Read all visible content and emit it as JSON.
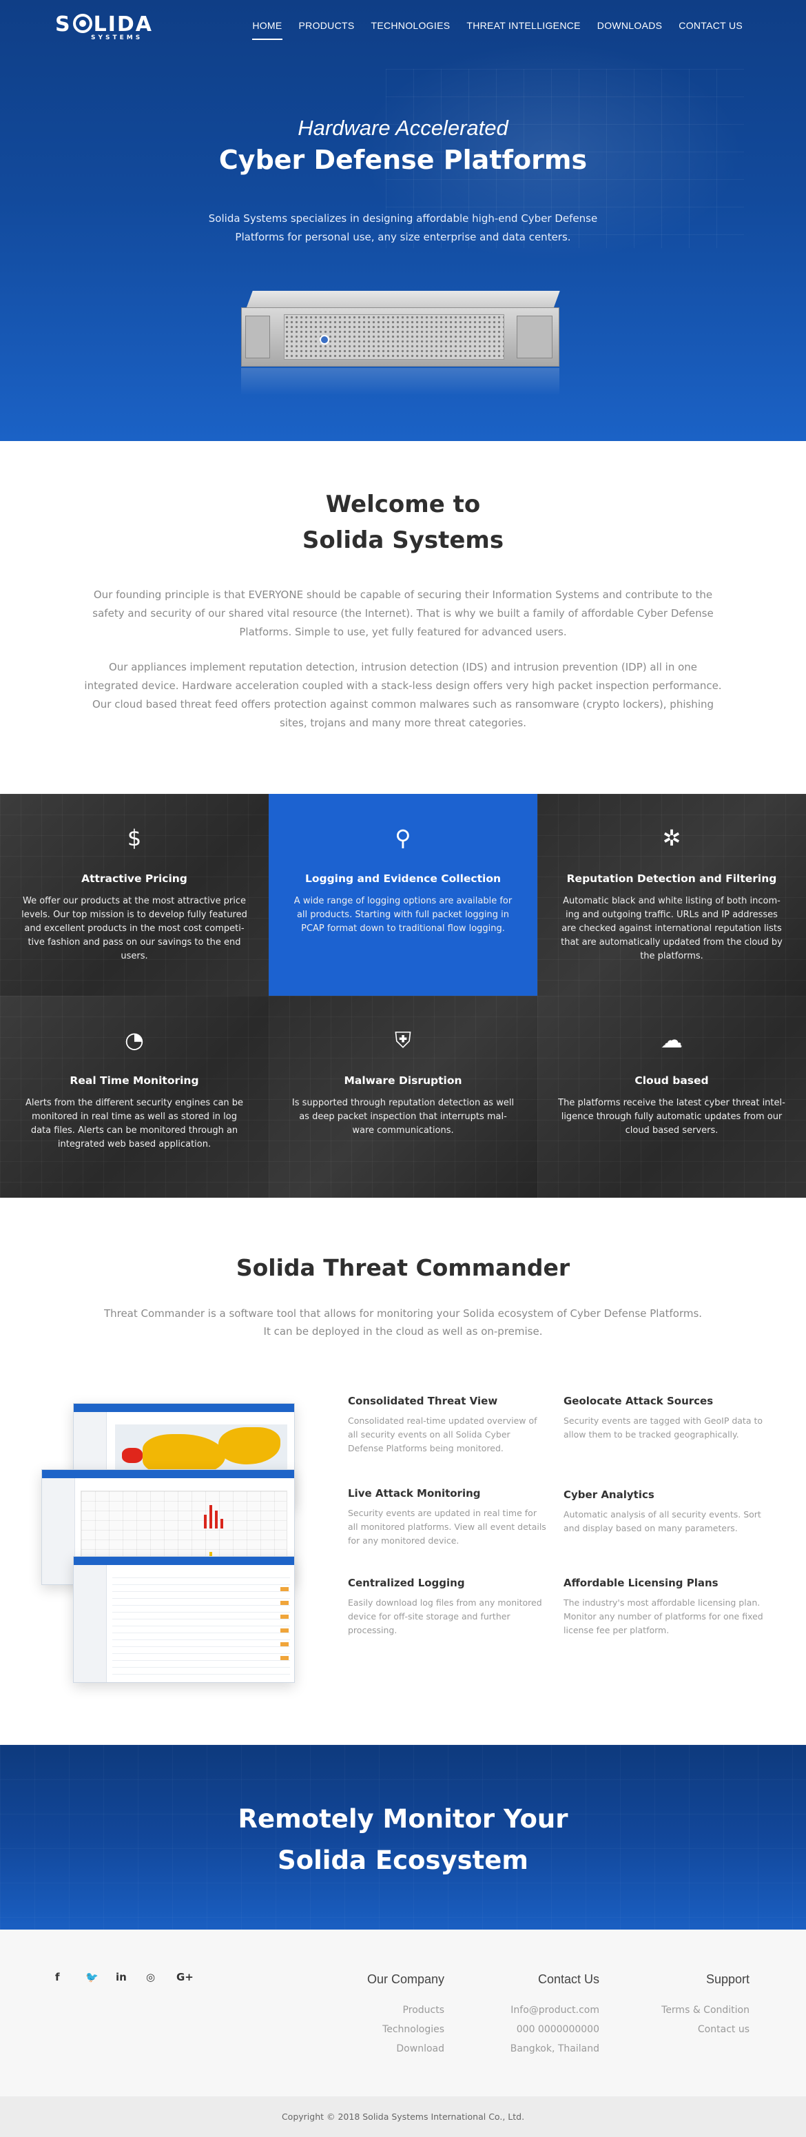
{
  "brand": {
    "name_left": "S",
    "name_right": "LIDA",
    "tagline": "SYSTEMS"
  },
  "nav": [
    {
      "label": "HOME",
      "active": true
    },
    {
      "label": "PRODUCTS",
      "active": false
    },
    {
      "label": "TECHNOLOGIES",
      "active": false
    },
    {
      "label": "THREAT INTELLIGENCE",
      "active": false
    },
    {
      "label": "DOWNLOADS",
      "active": false
    },
    {
      "label": "CONTACT US",
      "active": false
    }
  ],
  "hero": {
    "subtitle": "Hardware Accelerated",
    "title": "Cyber Defense Platforms",
    "text": "Solida Systems specializes in designing affordable high-end Cyber Defense Platforms for personal use, any size enterprise and data centers."
  },
  "welcome": {
    "title_line1": "Welcome to",
    "title_line2": "Solida Systems",
    "p1": "Our founding principle is that EVERYONE should be capable of securing their Information Systems and contribute to the safety and security of our shared vital resource (the Internet). That is why we built a family of affordable Cyber Defense Platforms. Simple to use, yet fully featured for advanced users.",
    "p2": "Our appliances implement reputation detection, intrusion detection (IDS) and intrusion prevention (IDP) all in one integrated device. Hardware acceleration coupled with a stack-less design offers very high packet inspection performance. Our cloud based threat feed offers protection against common malwares such as ransomware (crypto lockers), phishing sites, trojans and many more threat categories."
  },
  "features": [
    {
      "icon": "dollar-icon",
      "glyph": "$",
      "title": "Attractive Pricing",
      "text": "We offer our products at the most attractive price levels. Our top mission is to develop fully featured and excellent products in the most cost competi-tive fashion and pass on our savings to the end users."
    },
    {
      "icon": "magnifier-icon",
      "glyph": "⚲",
      "title": "Logging and Evidence Collection",
      "text": "A wide range of logging options are available for all products. Starting with full packet logging in PCAP format down to traditional flow logging."
    },
    {
      "icon": "network-icon",
      "glyph": "✲",
      "title": "Reputation Detection and Filtering",
      "text": "Automatic black and white listing of both incom-ing and outgoing traffic. URLs and IP addresses are checked against international reputation lists that are automatically updated from the cloud by the platforms."
    },
    {
      "icon": "clock-icon",
      "glyph": "◔",
      "title": "Real Time Monitoring",
      "text": "Alerts from the different security engines can be monitored in real time as well as stored in log data files. Alerts can be monitored through an integrated web based application."
    },
    {
      "icon": "shield-lock-icon",
      "glyph": "⛨",
      "title": "Malware Disruption",
      "text": "Is supported through reputation detection as well as deep packet inspection that interrupts mal-ware communications."
    },
    {
      "icon": "cloud-icon",
      "glyph": "☁",
      "title": "Cloud based",
      "text": "The platforms receive the latest cyber threat intel-ligence through fully automatic updates from our cloud based servers."
    }
  ],
  "threat_commander": {
    "title": "Solida Threat Commander",
    "text_line1": "Threat Commander is a software tool that allows for monitoring your Solida ecosystem of Cyber Defense Platforms.",
    "text_line2": "It can be deployed in the cloud as well as on-premise.",
    "items": [
      {
        "title": "Consolidated Threat View",
        "text": "Consolidated real-time updated overview of all security events on all Solida Cyber Defense Platforms being monitored."
      },
      {
        "title": "Geolocate Attack Sources",
        "text": "Security events are tagged with GeoIP data to allow them to be tracked geographically."
      },
      {
        "title": "Live Attack Monitoring",
        "text": "Security events are updated in real time for all monitored platforms. View all event details for any monitored device."
      },
      {
        "title": "Cyber Analytics",
        "text": "Automatic analysis of all security events. Sort and display based on many parameters."
      },
      {
        "title": "Centralized Logging",
        "text": "Easily download log files from any monitored device for off-site storage and further processing."
      },
      {
        "title": "Affordable Licensing Plans",
        "text": "The industry's most affordable licensing plan. Monitor any number of platforms for one fixed license fee per platform."
      }
    ]
  },
  "cta": {
    "line1": "Remotely Monitor Your",
    "line2": "Solida Ecosystem"
  },
  "footer": {
    "social": [
      {
        "name": "facebook-icon",
        "glyph": "f"
      },
      {
        "name": "twitter-icon",
        "glyph": "🐦"
      },
      {
        "name": "linkedin-icon",
        "glyph": "in"
      },
      {
        "name": "instagram-icon",
        "glyph": "◎"
      },
      {
        "name": "googleplus-icon",
        "glyph": "G+"
      }
    ],
    "company": {
      "heading": "Our Company",
      "links": [
        "Products",
        "Technologies",
        "Download"
      ]
    },
    "contact": {
      "heading": "Contact Us",
      "links": [
        "Info@product.com",
        "000 0000000000",
        "Bangkok, Thailand"
      ]
    },
    "support": {
      "heading": "Support",
      "links": [
        "Terms & Condition",
        "Contact us"
      ]
    },
    "copyright": "Copyright © 2018 Solida Systems International Co., Ltd."
  },
  "colors": {
    "primary_blue": "#1c62d0",
    "hero_dark": "#0f3e86",
    "dark_tile": "#333333",
    "heading": "#2f2f2f",
    "body_grey": "#8a8a8a"
  }
}
